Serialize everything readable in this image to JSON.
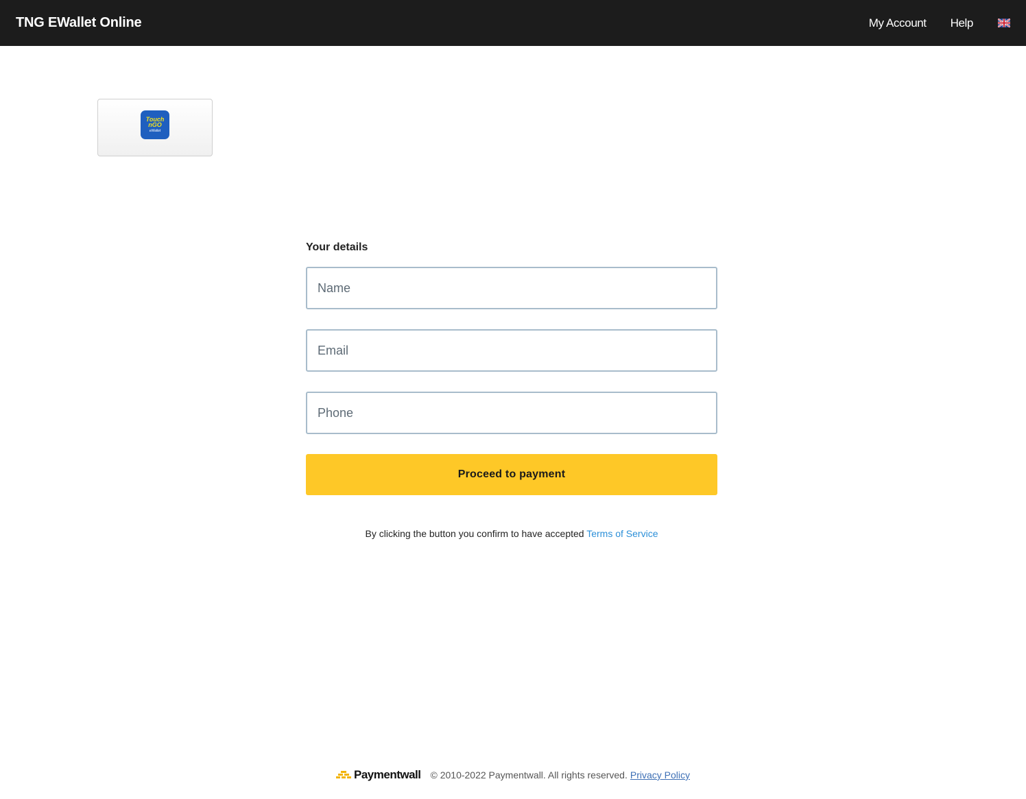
{
  "header": {
    "brand": "TNG EWallet Online",
    "nav": {
      "my_account": "My Account",
      "help": "Help",
      "language_icon": "uk-flag-icon"
    }
  },
  "payment_method": {
    "logo_line1": "Touch",
    "logo_line2": "nGO",
    "logo_line3": "eWallet",
    "icon": "touch-n-go-logo"
  },
  "form": {
    "title": "Your details",
    "name_placeholder": "Name",
    "email_placeholder": "Email",
    "phone_placeholder": "Phone",
    "submit_label": "Proceed to payment",
    "terms_text": "By clicking the button you confirm to have accepted",
    "terms_link": "Terms of Service"
  },
  "footer": {
    "logo_text": "Paymentwall",
    "copyright": "© 2010-2022 Paymentwall. All rights reserved.",
    "privacy_link": "Privacy Policy"
  },
  "colors": {
    "topbar": "#1c1c1c",
    "accent_button": "#fec827",
    "link": "#2b8fd8",
    "input_border": "#a8bccb"
  }
}
